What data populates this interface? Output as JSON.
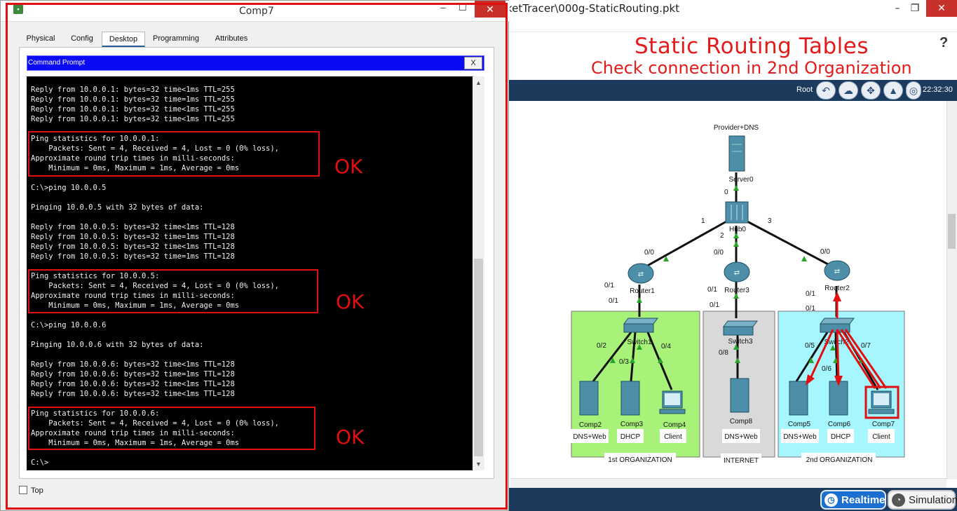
{
  "background_window": {
    "title": "ketTracer\\000g-StaticRouting.pkt",
    "min_symbol": "–",
    "max_symbol": "❐",
    "close_symbol": "✕",
    "slide_title": "Static Routing Tables",
    "slide_subtitle": "Check connection in 2nd Organization",
    "help_symbol": "?",
    "toolbar_root": "Root",
    "clock": "22:32:30",
    "realtime_label": "Realtime",
    "simulation_label": "Simulation"
  },
  "network": {
    "devices": [
      {
        "id": "server0",
        "name": "Server0",
        "extra": "Provider+DNS"
      },
      {
        "id": "hub0",
        "name": "Hub0"
      },
      {
        "id": "router1",
        "name": "Router1"
      },
      {
        "id": "router3",
        "name": "Router3"
      },
      {
        "id": "router2",
        "name": "Router2"
      },
      {
        "id": "switch1",
        "name": "Switch1"
      },
      {
        "id": "switch3",
        "name": "Switch3"
      },
      {
        "id": "switch2",
        "name": "Switch2"
      },
      {
        "id": "comp2",
        "name": "Comp2",
        "role": "DNS+Web"
      },
      {
        "id": "comp3",
        "name": "Comp3",
        "role": "DHCP"
      },
      {
        "id": "comp4",
        "name": "Comp4",
        "role": "Client"
      },
      {
        "id": "comp8",
        "name": "Comp8",
        "role": "DNS+Web"
      },
      {
        "id": "comp5",
        "name": "Comp5",
        "role": "DNS+Web"
      },
      {
        "id": "comp6",
        "name": "Comp6",
        "role": "DHCP"
      },
      {
        "id": "comp7",
        "name": "Comp7",
        "role": "Client"
      }
    ],
    "zones": [
      "1st ORGANIZATION",
      "INTERNET",
      "2nd ORGANIZATION"
    ],
    "port_labels": {
      "hub_0": "0",
      "hub_1": "1",
      "hub_2": "2",
      "hub_3": "3",
      "r1_00": "0/0",
      "r3_00": "0/0",
      "r2_00": "0/0",
      "r1_01a": "0/1",
      "r1_01b": "0/1",
      "r3_01a": "0/1",
      "r3_01b": "0/1",
      "r2_01a": "0/1",
      "r2_01b": "0/1",
      "s1_02": "0/2",
      "s1_03": "0/3",
      "s1_04": "0/4",
      "s3_08": "0/8",
      "s2_05": "0/5",
      "s2_06": "0/6",
      "s2_07": "0/7"
    }
  },
  "dialog": {
    "title": "Comp7",
    "min_symbol": "–",
    "max_symbol": "☐",
    "close_symbol": "✕",
    "tabs": [
      "Physical",
      "Config",
      "Desktop",
      "Programming",
      "Attributes"
    ],
    "active_tab": "Desktop",
    "command_prompt_title": "Command Prompt",
    "command_prompt_close": "X",
    "top_checkbox_label": "Top",
    "terminal_lines": [
      "Reply from 10.0.0.1: bytes=32 time<1ms TTL=255",
      "Reply from 10.0.0.1: bytes=32 time=1ms TTL=255",
      "Reply from 10.0.0.1: bytes=32 time<1ms TTL=255",
      "Reply from 10.0.0.1: bytes=32 time<1ms TTL=255",
      "",
      "Ping statistics for 10.0.0.1:",
      "    Packets: Sent = 4, Received = 4, Lost = 0 (0% loss),",
      "Approximate round trip times in milli-seconds:",
      "    Minimum = 0ms, Maximum = 1ms, Average = 0ms",
      "",
      "C:\\>ping 10.0.0.5",
      "",
      "Pinging 10.0.0.5 with 32 bytes of data:",
      "",
      "Reply from 10.0.0.5: bytes=32 time<1ms TTL=128",
      "Reply from 10.0.0.5: bytes=32 time=1ms TTL=128",
      "Reply from 10.0.0.5: bytes=32 time<1ms TTL=128",
      "Reply from 10.0.0.5: bytes=32 time=1ms TTL=128",
      "",
      "Ping statistics for 10.0.0.5:",
      "    Packets: Sent = 4, Received = 4, Lost = 0 (0% loss),",
      "Approximate round trip times in milli-seconds:",
      "    Minimum = 0ms, Maximum = 1ms, Average = 0ms",
      "",
      "C:\\>ping 10.0.0.6",
      "",
      "Pinging 10.0.0.6 with 32 bytes of data:",
      "",
      "Reply from 10.0.0.6: bytes=32 time<1ms TTL=128",
      "Reply from 10.0.0.6: bytes=32 time=1ms TTL=128",
      "Reply from 10.0.0.6: bytes=32 time<1ms TTL=128",
      "Reply from 10.0.0.6: bytes=32 time<1ms TTL=128",
      "",
      "Ping statistics for 10.0.0.6:",
      "    Packets: Sent = 4, Received = 4, Lost = 0 (0% loss),",
      "Approximate round trip times in milli-seconds:",
      "    Minimum = 0ms, Maximum = 1ms, Average = 0ms",
      "",
      "C:\\>"
    ],
    "annotations": [
      "OK",
      "OK",
      "OK"
    ]
  },
  "colors": {
    "highlight_red": "#e01010",
    "cmd_header_blue": "#0a0af5",
    "zone_green": "#a8f27a",
    "zone_gray": "#d9d9d9",
    "zone_cyan": "#a6f6ff",
    "link_green": "#2aa52a"
  },
  "icons": {
    "app": "packet-tracer-icon",
    "help": "help-icon",
    "toolbar": [
      "back-icon",
      "cloud-icon",
      "navigate-icon",
      "background-image-icon",
      "viewport-icon"
    ]
  }
}
